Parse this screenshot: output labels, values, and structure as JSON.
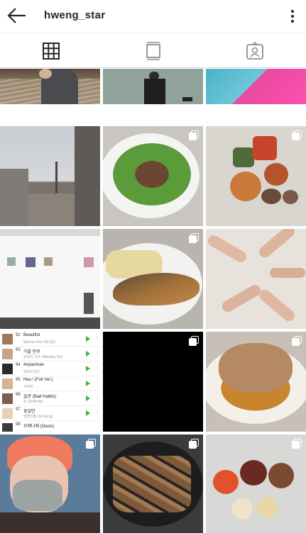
{
  "header": {
    "username": "hweng_star",
    "back_icon": "arrow-left-icon",
    "more_icon": "more-vertical-icon"
  },
  "tabs": [
    {
      "name": "grid",
      "icon": "grid-icon",
      "active": true
    },
    {
      "name": "feed",
      "icon": "feed-icon",
      "active": false
    },
    {
      "name": "tagged",
      "icon": "tagged-person-icon",
      "active": false
    }
  ],
  "colors": {
    "accent": "#262626",
    "inactive_icon": "#8e8e8e",
    "play_green": "#3ab54a"
  },
  "songs": [
    {
      "num": "92",
      "title": "Beautiful",
      "artist": "Wanna One (워너원)"
    },
    {
      "num": "93",
      "title": "가을 안부",
      "artist": "먼데이 키즈 (Monday Kiz)"
    },
    {
      "num": "94",
      "title": "Anpanman",
      "artist": "방탄소년단"
    },
    {
      "num": "95",
      "title": "Heu ! (Full Ver.)",
      "artist": "수퍼비"
    },
    {
      "num": "96",
      "title": "습관 (Bad Habits)",
      "artist": "숀 (SHAUN)"
    },
    {
      "num": "97",
      "title": "꽃길만",
      "artist": "멋쟁이들 (N.Flying)"
    },
    {
      "num": "98",
      "title": "모레나래 (Oasis)",
      "artist": ""
    }
  ],
  "posts": [
    {
      "row": 0,
      "col": 0,
      "desc": "person crouching on stairs",
      "multi": false
    },
    {
      "row": 0,
      "col": 1,
      "desc": "person standing by wall",
      "multi": false
    },
    {
      "row": 0,
      "col": 2,
      "desc": "pink shirt",
      "multi": false
    },
    {
      "row": 1,
      "col": 0,
      "desc": "street with power lines",
      "multi": false
    },
    {
      "row": 1,
      "col": 1,
      "desc": "meat on lettuce",
      "multi": true
    },
    {
      "row": 1,
      "col": 2,
      "desc": "dinner table",
      "multi": true
    },
    {
      "row": 2,
      "col": 0,
      "desc": "music app screen",
      "multi": false
    },
    {
      "row": 2,
      "col": 1,
      "desc": "fish and rolled eggs",
      "multi": true
    },
    {
      "row": 2,
      "col": 2,
      "desc": "hands forming star",
      "multi": false
    },
    {
      "row": 3,
      "col": 0,
      "desc": "playlist screenshot",
      "multi": false
    },
    {
      "row": 3,
      "col": 1,
      "desc": "black image",
      "multi": true
    },
    {
      "row": 3,
      "col": 2,
      "desc": "braised chicken",
      "multi": true
    },
    {
      "row": 4,
      "col": 0,
      "desc": "selfie with mask",
      "multi": true
    },
    {
      "row": 4,
      "col": 1,
      "desc": "eel on grill",
      "multi": true
    },
    {
      "row": 4,
      "col": 2,
      "desc": "table with dishes",
      "multi": true
    }
  ]
}
